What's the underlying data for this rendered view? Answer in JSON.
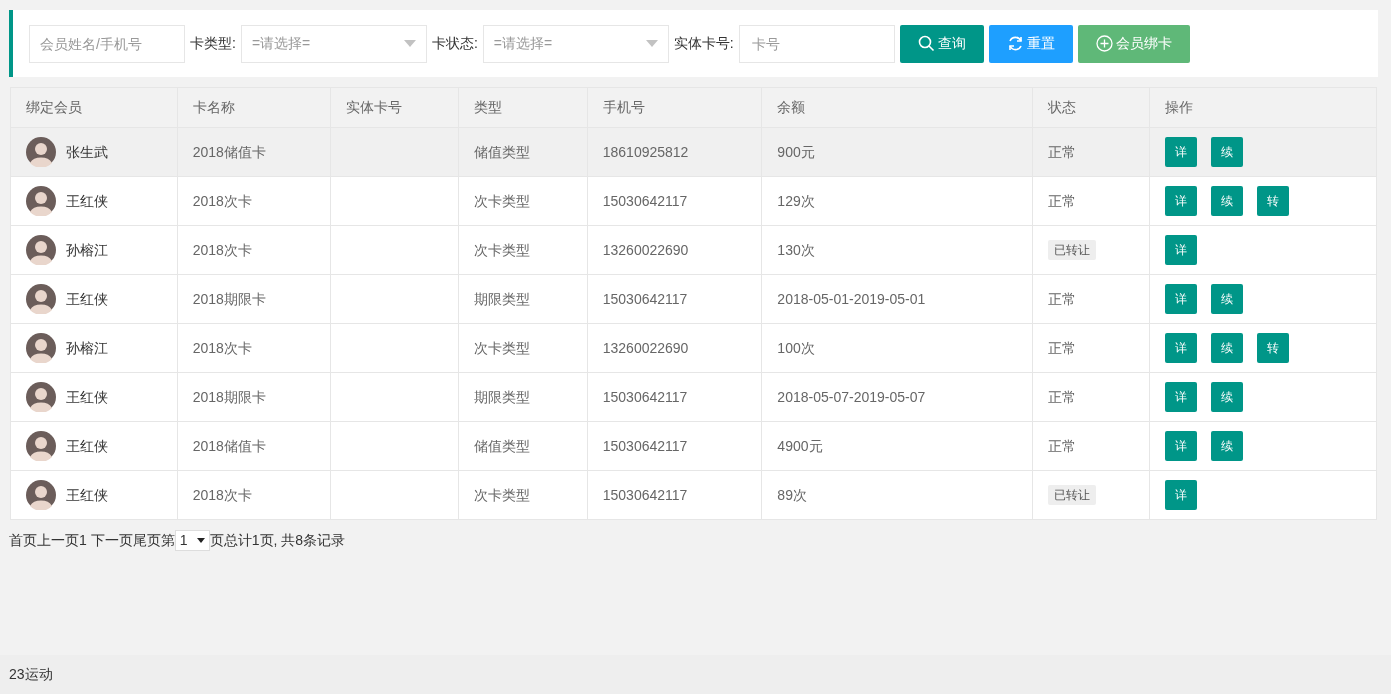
{
  "search": {
    "member_placeholder": "会员姓名/手机号",
    "card_type_label": "卡类型:",
    "card_type_value": "=请选择=",
    "card_status_label": "卡状态:",
    "card_status_value": "=请选择=",
    "card_no_label": "实体卡号:",
    "card_no_placeholder": "卡号",
    "buttons": [
      {
        "kind": "search",
        "label": "查询"
      },
      {
        "kind": "reset",
        "label": "重置"
      },
      {
        "kind": "bind",
        "label": "会员绑卡"
      }
    ]
  },
  "table": {
    "columns": [
      "绑定会员",
      "卡名称",
      "实体卡号",
      "类型",
      "手机号",
      "余额",
      "状态",
      "操作"
    ],
    "rows": [
      {
        "selected": true,
        "member": "张生武",
        "card_name": "2018储值卡",
        "type": "储值类型",
        "phone": "18610925812",
        "balance": "900元",
        "status": {
          "kind": "plain",
          "text": "正常"
        },
        "actions": [
          "详",
          "续"
        ]
      },
      {
        "selected": false,
        "member": "王红侠",
        "card_name": "2018次卡",
        "type": "次卡类型",
        "phone": "15030642117",
        "balance": "129次",
        "status": {
          "kind": "plain",
          "text": "正常"
        },
        "actions": [
          "详",
          "续",
          "转"
        ]
      },
      {
        "selected": false,
        "member": "孙榕江",
        "card_name": "2018次卡",
        "type": "次卡类型",
        "phone": "13260022690",
        "balance": "130次",
        "status": {
          "kind": "badge",
          "text": "已转让"
        },
        "actions": [
          "详"
        ]
      },
      {
        "selected": false,
        "member": "王红侠",
        "card_name": "2018期限卡",
        "type": "期限类型",
        "phone": "15030642117",
        "balance": "2018-05-01-2019-05-01",
        "status": {
          "kind": "plain",
          "text": "正常"
        },
        "actions": [
          "详",
          "续"
        ]
      },
      {
        "selected": false,
        "member": "孙榕江",
        "card_name": "2018次卡",
        "type": "次卡类型",
        "phone": "13260022690",
        "balance": "100次",
        "status": {
          "kind": "plain",
          "text": "正常"
        },
        "actions": [
          "详",
          "续",
          "转"
        ]
      },
      {
        "selected": false,
        "member": "王红侠",
        "card_name": "2018期限卡",
        "type": "期限类型",
        "phone": "15030642117",
        "balance": "2018-05-07-2019-05-07",
        "status": {
          "kind": "plain",
          "text": "正常"
        },
        "actions": [
          "详",
          "续"
        ]
      },
      {
        "selected": false,
        "member": "王红侠",
        "card_name": "2018储值卡",
        "type": "储值类型",
        "phone": "15030642117",
        "balance": "4900元",
        "status": {
          "kind": "plain",
          "text": "正常"
        },
        "actions": [
          "详",
          "续"
        ]
      },
      {
        "selected": false,
        "member": "王红侠",
        "card_name": "2018次卡",
        "type": "次卡类型",
        "phone": "15030642117",
        "balance": "89次",
        "status": {
          "kind": "badge",
          "text": "已转让"
        },
        "actions": [
          "详"
        ]
      }
    ]
  },
  "pagination": {
    "links": [
      "首页",
      "上一页",
      "1",
      "下一页",
      "尾页"
    ],
    "page_prefix": "第",
    "page_value": "1",
    "summary": "页总计1页, 共8条记录"
  },
  "footer": "23运动"
}
